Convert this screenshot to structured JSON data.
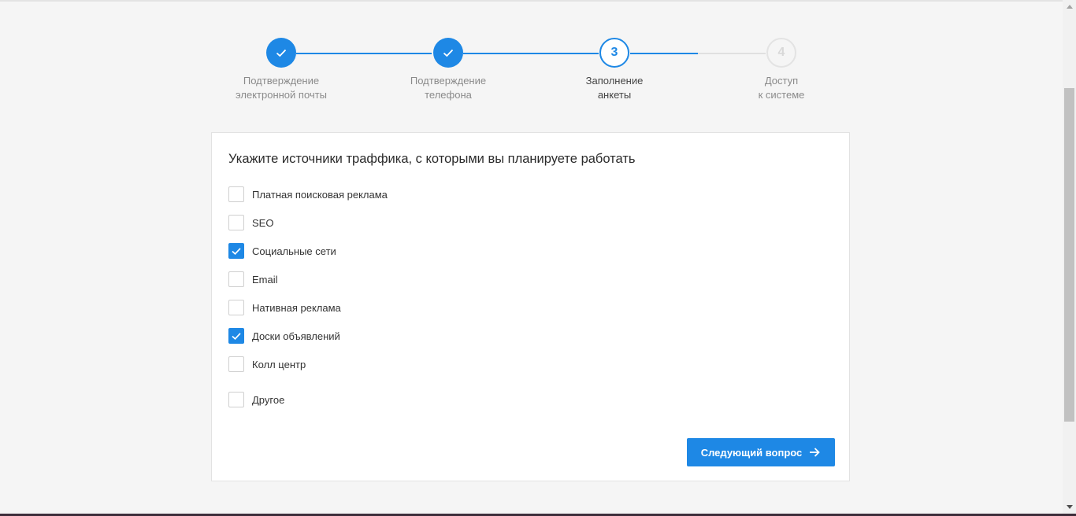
{
  "stepper": {
    "steps": [
      {
        "label": "Подтверждение\nэлектронной почты",
        "state": "done",
        "number": "1"
      },
      {
        "label": "Подтверждение\nтелефона",
        "state": "done",
        "number": "2"
      },
      {
        "label": "Заполнение\nанкеты",
        "state": "active",
        "number": "3"
      },
      {
        "label": "Доступ\nк системе",
        "state": "pending",
        "number": "4"
      }
    ]
  },
  "form": {
    "title": "Укажите источники траффика, с которыми вы планируете работать",
    "options": [
      {
        "label": "Платная поисковая реклама",
        "checked": false
      },
      {
        "label": "SEO",
        "checked": false
      },
      {
        "label": "Социальные сети",
        "checked": true
      },
      {
        "label": "Email",
        "checked": false
      },
      {
        "label": "Нативная реклама",
        "checked": false
      },
      {
        "label": "Доски объявлений",
        "checked": true
      },
      {
        "label": "Колл центр",
        "checked": false
      },
      {
        "label": "Другое",
        "checked": false
      }
    ],
    "next_button_label": "Следующий вопрос"
  },
  "colors": {
    "accent": "#1e88e5",
    "background": "#f5f5f5",
    "card": "#ffffff"
  }
}
